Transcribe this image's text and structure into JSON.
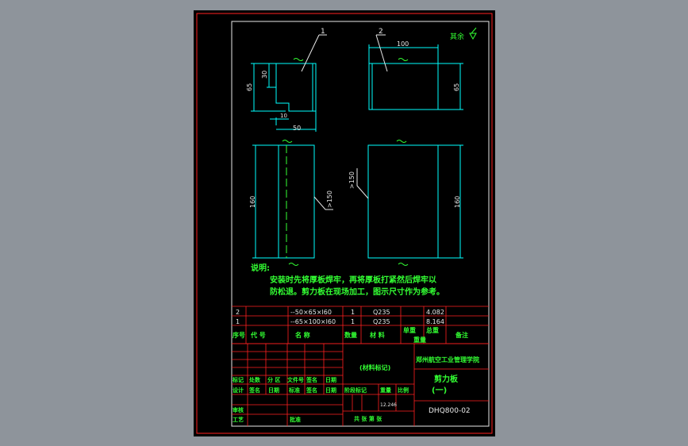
{
  "colors": {
    "viewport_bg": "#8e949b",
    "sheet_bg": "#000000",
    "frame": "#ff2020",
    "outline": "#00ffff",
    "text_green": "#33ff33",
    "text_white": "#e8e8e8",
    "centerline": "#33ff33"
  },
  "part_labels": [
    "1",
    "2"
  ],
  "surface_note": "其余",
  "dimensions": {
    "v1_height": "65",
    "v1_inner": "30",
    "v1_thk": "10",
    "v1_width": "50",
    "v2_width": "100",
    "v2_height": "65",
    "v3_height": "160",
    "v3_weld": ">150",
    "v4_weld": ">150",
    "v4_height": "160"
  },
  "notes": {
    "title": "说明:",
    "line1": "安装时先将厚板焊牢，再将厚板打紧然后焊牢以",
    "line2": "防松退。剪力板在现场加工，图示尺寸作为参考。"
  },
  "bom": {
    "rows": [
      {
        "no": "2",
        "spec": "--50×65×l60",
        "qty": "1",
        "material": "Q235",
        "unit_weight": "",
        "total_weight": "4.082"
      },
      {
        "no": "1",
        "spec": "--65×100×l60",
        "qty": "1",
        "material": "Q235",
        "unit_weight": "",
        "total_weight": "8.164"
      }
    ],
    "headers": {
      "no": "序号",
      "code": "代  号",
      "name": "名      称",
      "qty": "数量",
      "material": "材  料",
      "unit_weight": "单重",
      "total_weight": "总重",
      "weight": "重量",
      "remark": "备注"
    }
  },
  "title_block": {
    "material_mark": "(材料标记)",
    "institute": "郑州航空工业管理学院",
    "part_name": "剪力板",
    "part_sub": "(一)",
    "drawing_no": "DHQ800-02",
    "row_mark": [
      "标记",
      "处数",
      "分 区",
      "文件号",
      "签名",
      "日期"
    ],
    "row_design": [
      "设计",
      "签名",
      "日期",
      "标准",
      "签名",
      "日期"
    ],
    "stage_labels": [
      "阶段标记",
      "重量",
      "比例"
    ],
    "weight": "12.246",
    "sheet_info": "共    张   第   张",
    "review": "审核",
    "process": "工艺",
    "approve": "批准"
  }
}
